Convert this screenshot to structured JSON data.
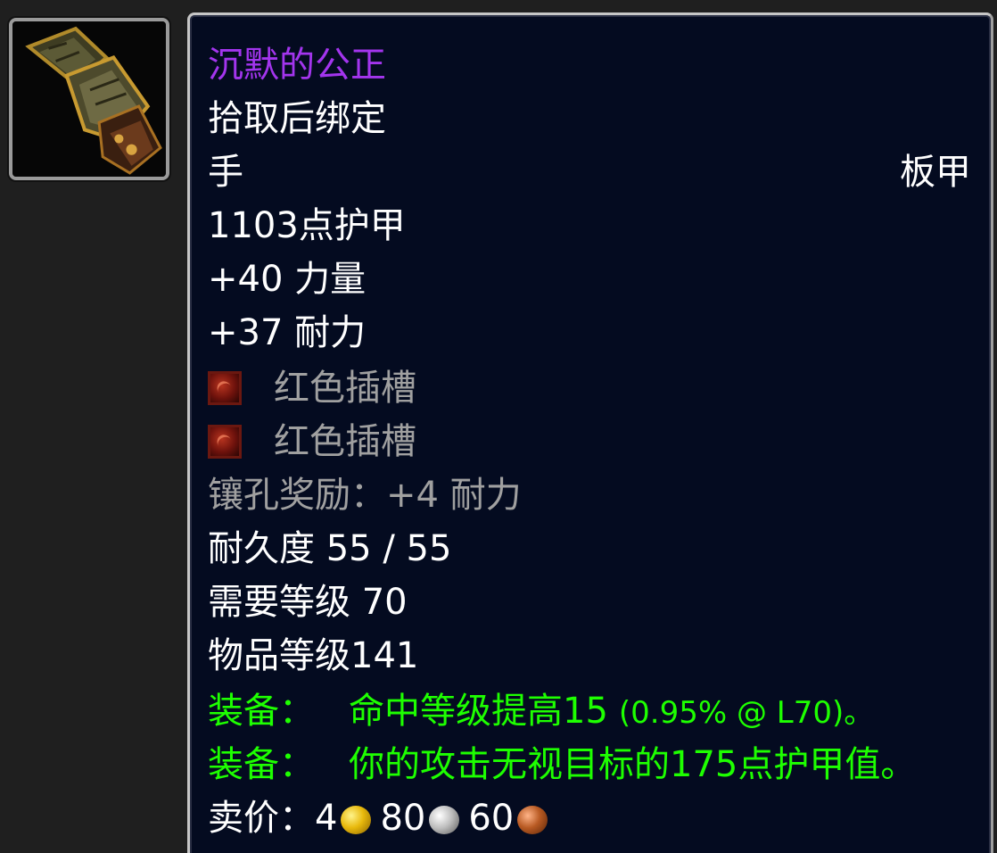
{
  "item": {
    "name": "沉默的公正",
    "binding": "拾取后绑定",
    "slot": "手",
    "armor_type": "板甲",
    "armor": "1103点护甲",
    "stats": [
      "+40 力量",
      "+37 耐力"
    ],
    "sockets": [
      {
        "label": "红色插槽",
        "color": "#a0a0a0"
      },
      {
        "label": "红色插槽",
        "color": "#a0a0a0"
      }
    ],
    "socket_bonus": "镶孔奖励：+4 耐力",
    "durability": "耐久度 55 / 55",
    "required_level": "需要等级 70",
    "item_level": "物品等级141",
    "equip_effects": [
      {
        "prefix": "装备：",
        "text": "命中等级提高15",
        "note": "(0.95% @ L70)。"
      },
      {
        "prefix": "装备：",
        "text": "你的攻击无视目标的175点护甲值。",
        "note": ""
      }
    ],
    "sell_price": {
      "label": "卖价：",
      "gold": "4",
      "silver": "80",
      "copper": "60"
    },
    "icon": "plate-gauntlet-icon"
  },
  "colors": {
    "epic": "#a335ee",
    "white": "#ffffff",
    "grey": "#a0a0a0",
    "green": "#1eff00",
    "background": "#040b20"
  }
}
